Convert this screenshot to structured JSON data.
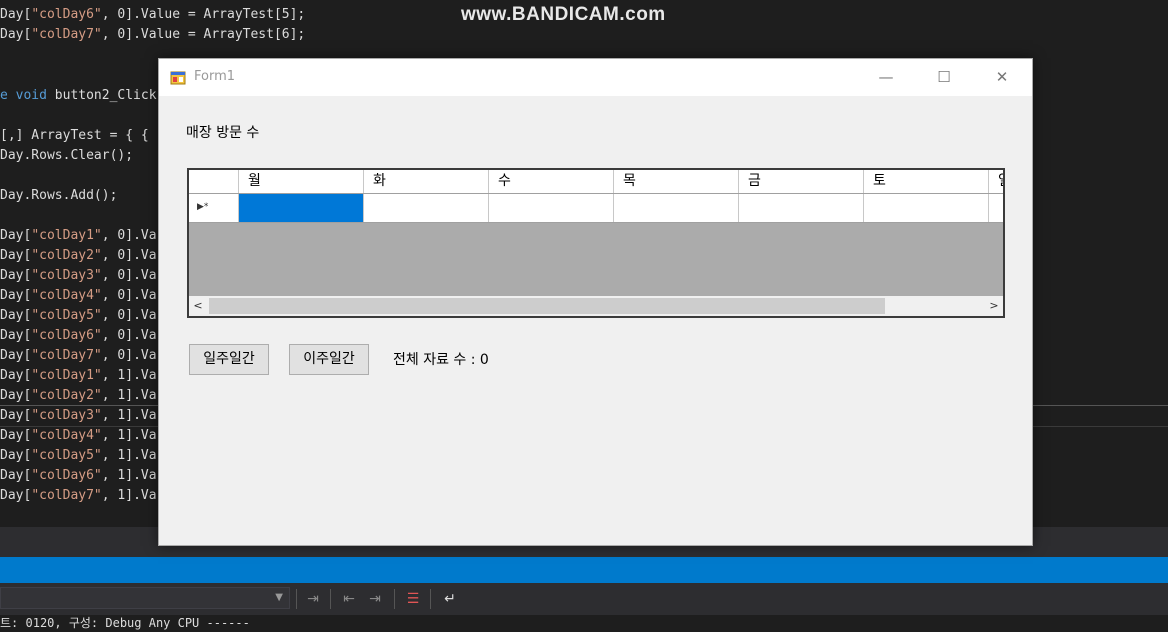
{
  "watermark": "www.BANDICAM.com",
  "code_lines": [
    {
      "prefix": "Day[",
      "str": "\"colDay6\"",
      "rest": ", 0].Value = ArrayTest[5];"
    },
    {
      "prefix": "Day[",
      "str": "\"colDay7\"",
      "rest": ", 0].Value = ArrayTest[6];"
    },
    {
      "prefix": "",
      "kw": "e void",
      "rest": " button2_Click("
    },
    {
      "prefix": "[,] ArrayTest = { {",
      "str": "",
      "rest": ""
    },
    {
      "prefix": "Day.Rows.Clear();",
      "str": "",
      "rest": ""
    },
    {
      "prefix": "Day.Rows.Add();",
      "str": "",
      "rest": ""
    },
    {
      "prefix": "Day[",
      "str": "\"colDay1\"",
      "rest": ", 0].Va"
    },
    {
      "prefix": "Day[",
      "str": "\"colDay2\"",
      "rest": ", 0].Va"
    },
    {
      "prefix": "Day[",
      "str": "\"colDay3\"",
      "rest": ", 0].Va"
    },
    {
      "prefix": "Day[",
      "str": "\"colDay4\"",
      "rest": ", 0].Va"
    },
    {
      "prefix": "Day[",
      "str": "\"colDay5\"",
      "rest": ", 0].Va"
    },
    {
      "prefix": "Day[",
      "str": "\"colDay6\"",
      "rest": ", 0].Va"
    },
    {
      "prefix": "Day[",
      "str": "\"colDay7\"",
      "rest": ", 0].Va"
    },
    {
      "prefix": "Day[",
      "str": "\"colDay1\"",
      "rest": ", 1].Va"
    },
    {
      "prefix": "Day[",
      "str": "\"colDay2\"",
      "rest": ", 1].Va"
    },
    {
      "prefix": "Day[",
      "str": "\"colDay3\"",
      "rest": ", 1].Va"
    },
    {
      "prefix": "Day[",
      "str": "\"colDay4\"",
      "rest": ", 1].Va"
    },
    {
      "prefix": "Day[",
      "str": "\"colDay5\"",
      "rest": ", 1].Va"
    },
    {
      "prefix": "Day[",
      "str": "\"colDay6\"",
      "rest": ", 1].Va"
    },
    {
      "prefix": "Day[",
      "str": "\"colDay7\"",
      "rest": ", 1].Va"
    }
  ],
  "output_text": "트: 0120, 구성: Debug Any CPU ------",
  "form": {
    "title": "Form1",
    "minimize": "—",
    "maximize": "☐",
    "close": "✕",
    "label_main": "매장 방문 수",
    "grid": {
      "columns": [
        "월",
        "화",
        "수",
        "목",
        "금",
        "토",
        "일"
      ],
      "new_row_glyph": "▶*",
      "scroll_left": "<",
      "scroll_right": ">"
    },
    "button_one_week": "일주일간",
    "button_two_weeks": "이주일간",
    "total_label": "전체 자료 수 : 0"
  },
  "colors": {
    "accent_blue": "#007acc",
    "selected_cell": "#0078d7"
  }
}
